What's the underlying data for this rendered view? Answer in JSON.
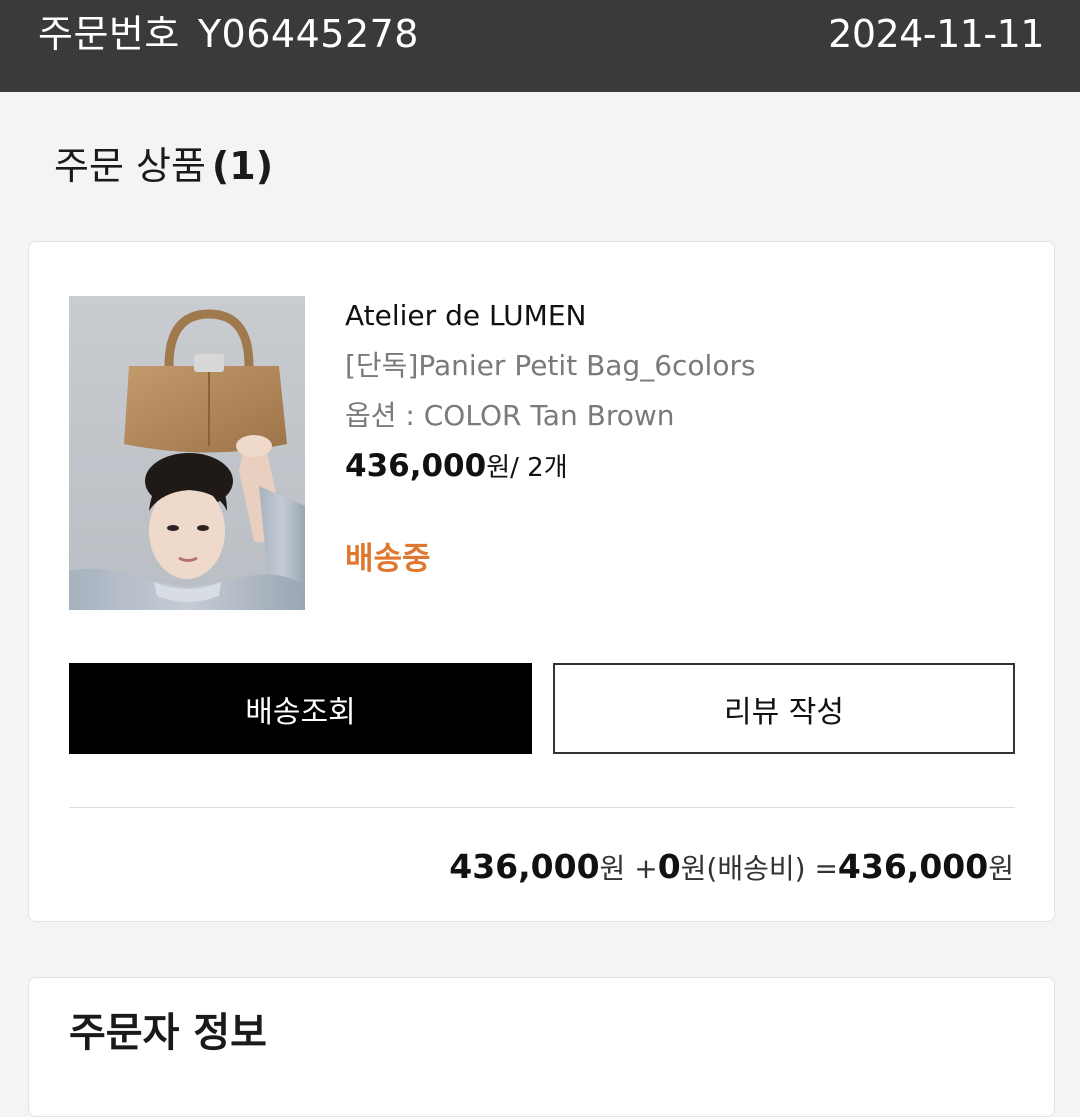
{
  "header": {
    "order_label": "주문번호",
    "order_number": "Y06445278",
    "order_date": "2024-11-11"
  },
  "section": {
    "title": "주문 상품",
    "count": "(1)"
  },
  "product": {
    "brand": "Atelier de LUMEN",
    "name": "[단독]Panier Petit Bag_6colors",
    "option": "옵션 : COLOR Tan Brown",
    "price_amount": "436,000",
    "price_unit": "원",
    "quantity": "/ 2개",
    "status": "배송중",
    "status_color": "#e0772e"
  },
  "buttons": {
    "track_label": "배송조회",
    "review_label": "리뷰 작성"
  },
  "total": {
    "items_amount": "436,000",
    "items_unit": "원",
    "plus": " +",
    "shipping_amount": "0",
    "shipping_unit": "원(배송비)",
    "equals": " =",
    "grand_amount": "436,000",
    "grand_unit": "원"
  },
  "orderer_section": {
    "title": "주문자 정보"
  }
}
